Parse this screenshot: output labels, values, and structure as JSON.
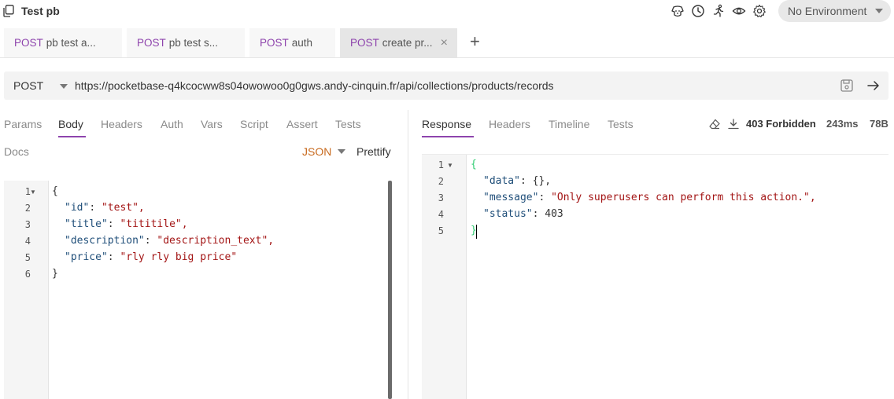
{
  "app": {
    "title": "Test pb",
    "environment": "No Environment"
  },
  "top_icons": [
    "bruno-dog-icon",
    "history-icon",
    "runner-icon",
    "eye-icon",
    "gear-icon"
  ],
  "tabs": [
    {
      "method": "POST",
      "label": "pb test a..."
    },
    {
      "method": "POST",
      "label": "pb test s..."
    },
    {
      "method": "POST",
      "label": "auth"
    },
    {
      "method": "POST",
      "label": "create pr...",
      "active": true,
      "close": "×"
    }
  ],
  "tab_add": "+",
  "request": {
    "method": "POST",
    "url": "https://pocketbase-q4kcocww8s04owowoo0g0gws.andy-cinquin.fr/api/collections/products/records"
  },
  "request_tabs": [
    "Params",
    "Body",
    "Headers",
    "Auth",
    "Vars",
    "Script",
    "Assert",
    "Tests",
    "Docs"
  ],
  "request_active_tab": "Body",
  "body_mode": "JSON",
  "prettify_label": "Prettify",
  "request_body": {
    "line_numbers": [
      "1",
      "2",
      "3",
      "4",
      "5",
      "6"
    ],
    "open": "{",
    "close": "}",
    "fields": [
      {
        "key": "\"id\"",
        "value": "\"test\","
      },
      {
        "key": "\"title\"",
        "value": "\"tititile\","
      },
      {
        "key": "\"description\"",
        "value": "\"description_text\","
      },
      {
        "key": "\"price\"",
        "value": "\"rly rly big price\""
      }
    ]
  },
  "response_tabs": [
    "Response",
    "Headers",
    "Timeline",
    "Tests"
  ],
  "response_active_tab": "Response",
  "response_status": {
    "status": "403 Forbidden",
    "time": "243ms",
    "size": "78B"
  },
  "response_body": {
    "line_numbers": [
      "1",
      "2",
      "3",
      "4",
      "5"
    ],
    "open": "{",
    "close": "}",
    "lines": [
      {
        "key": "\"data\"",
        "value": "{},",
        "value_type": "punct"
      },
      {
        "key": "\"message\"",
        "value": "\"Only superusers can perform this action.\",",
        "value_type": "string"
      },
      {
        "key": "\"status\"",
        "value": "403",
        "value_type": "number"
      }
    ]
  },
  "colors": {
    "method": "#8e44ad",
    "json_key": "#1f4e79",
    "json_string": "#a31515",
    "body_mode": "#c86a1e"
  }
}
